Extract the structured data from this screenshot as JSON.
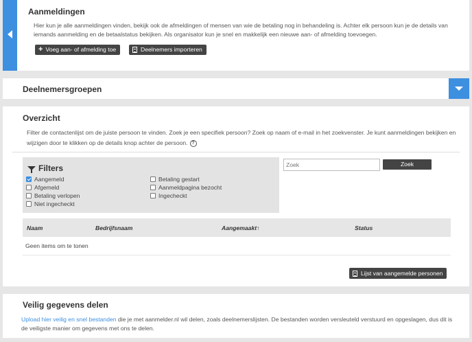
{
  "aanmeldingen": {
    "title": "Aanmeldingen",
    "description": "Hier kun je alle aanmeldingen vinden, bekijk ook de afmeldingen of mensen van wie de betaling nog in behandeling is. Achter elk persoon kun je de details van iemands aanmelding en de betaalstatus bekijken. Als organisator kun je snel en makkelijk een nieuwe aan- of afmelding toevoegen.",
    "add_button": "Voeg aan- of afmelding toe",
    "import_button": "Deelnemers importeren"
  },
  "groepen": {
    "title": "Deelnemersgroepen"
  },
  "overzicht": {
    "title": "Overzicht",
    "description": "Filter de contactenlijst om de juiste persoon te vinden. Zoek je een specifiek persoon? Zoek op naam of e-mail in het zoekvenster. Je kunt aanmeldingen bekijken en wijzigen door te klikken op de details knop achter de persoon.",
    "help_icon": "?",
    "filters_title": "Filters",
    "filters": [
      {
        "label": "Aangemeld",
        "checked": true
      },
      {
        "label": "Afgemeld",
        "checked": false
      },
      {
        "label": "Betaling verlopen",
        "checked": false
      },
      {
        "label": "Niet ingecheckt",
        "checked": false
      },
      {
        "label": "Betaling gestart",
        "checked": false
      },
      {
        "label": "Aanmeldpagina bezocht",
        "checked": false
      },
      {
        "label": "Ingecheckt",
        "checked": false
      }
    ],
    "search_placeholder": "Zoek",
    "search_button": "Zoek",
    "columns": [
      "Naam",
      "Bedrijfsnaam",
      "Aangemaakt↑",
      "Status"
    ],
    "empty_text": "Geen items om te tonen",
    "list_button": "Lijst van aangemelde personen"
  },
  "veilig": {
    "title": "Veilig gegevens delen",
    "link_text": "Upload hier veilig en snel bestanden",
    "description": " die je met aanmelder.nl wil delen, zoals deelnemerslijsten. De bestanden worden versleuteld verstuurd en opgeslagen, dus dit is de veiligste manier om gegevens met ons te delen."
  },
  "colors": {
    "accent": "#3d8fe0",
    "dark_button": "#444444"
  }
}
